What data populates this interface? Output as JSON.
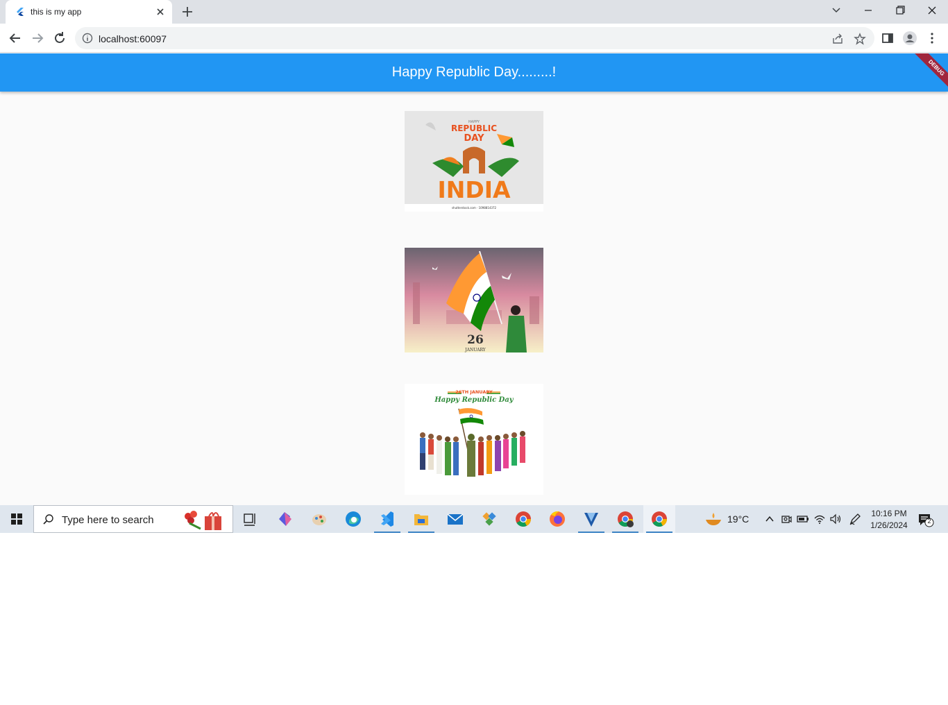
{
  "browser": {
    "tab_title": "this is my app",
    "url": "localhost:60097"
  },
  "app": {
    "title": "Happy Republic Day.........!",
    "debug_label": "DEBUG",
    "images": [
      {
        "name": "republic-day-india-poster",
        "lines": [
          "HAPPY",
          "REPUBLIC",
          "DAY",
          "INDIA",
          "shutterstock.com · 1098814372"
        ]
      },
      {
        "name": "girl-waving-flag-poster",
        "lines": [
          "26",
          "JANUARY"
        ]
      },
      {
        "name": "people-with-flag-poster",
        "lines": [
          "26TH JANUARY",
          "Happy Republic Day"
        ]
      }
    ]
  },
  "taskbar": {
    "search_placeholder": "Type here to search",
    "weather": "19°C",
    "time": "10:16 PM",
    "date": "1/26/2024",
    "notification_count": "2"
  },
  "colors": {
    "appbar": "#2196f3",
    "saffron": "#ff9933",
    "green": "#138808",
    "navy": "#000080"
  }
}
